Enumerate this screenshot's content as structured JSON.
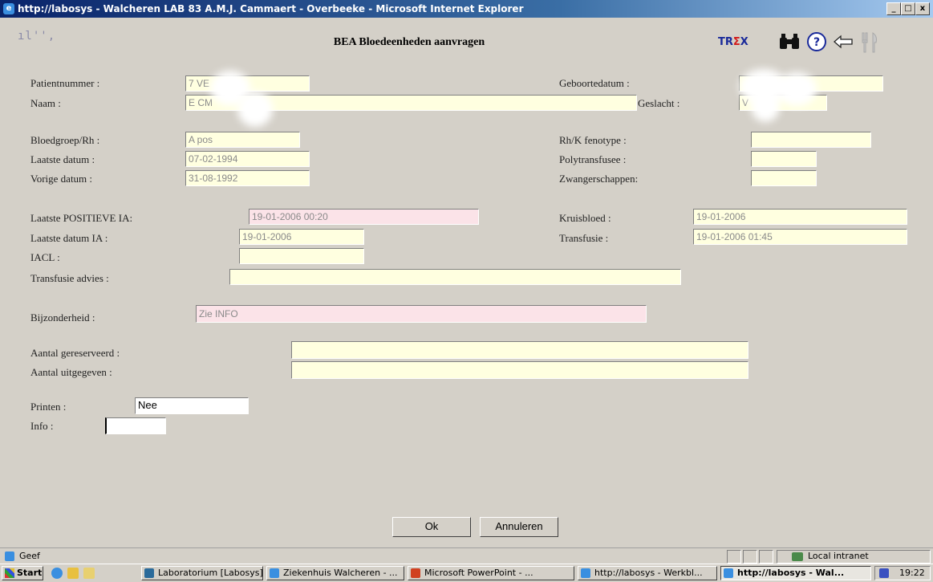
{
  "window": {
    "title": "http://labosys - Walcheren LAB 83 A.M.J. Cammaert - Overbeeke - Microsoft Internet Explorer",
    "controls": [
      "_",
      "□",
      "x"
    ]
  },
  "header": {
    "logo_text": "ıl'',",
    "page_title": "BEA Bloedeenheden aanvragen",
    "trex": {
      "tr": "TR",
      "e": "Σ",
      "x": "X"
    },
    "icons": [
      "binoculars-icon",
      "help-icon",
      "back-arrow-icon",
      "fork-knife-icon"
    ]
  },
  "patient": {
    "patientnummer_label": "Patientnummer :",
    "patientnummer_value": "7 VE",
    "geboortedatum_label": "Geboortedatum :",
    "geboortedatum_value": "",
    "naam_label": "Naam :",
    "naam_value": "E CM",
    "geslacht_label": "Geslacht :",
    "geslacht_value": "V"
  },
  "blood": {
    "bloedgroep_label": "Bloedgroep/Rh :",
    "bloedgroep_value": "A pos",
    "rhk_label": "Rh/K fenotype :",
    "rhk_value": "",
    "laatste_datum_label": "Laatste datum :",
    "laatste_datum_value": "07-02-1994",
    "polytransfusee_label": "Polytransfusee :",
    "polytransfusee_value": "",
    "vorige_datum_label": "Vorige datum :",
    "vorige_datum_value": "31-08-1992",
    "zwangerschappen_label": "Zwangerschappen:",
    "zwangerschappen_value": ""
  },
  "ia": {
    "laatste_positieve_label": "Laatste POSITIEVE IA:",
    "laatste_positieve_value": "19-01-2006 00:20",
    "kruisbloed_label": "Kruisbloed :",
    "kruisbloed_value": "19-01-2006",
    "laatste_datum_ia_label": "Laatste datum IA :",
    "laatste_datum_ia_value": "19-01-2006",
    "transfusie_label": "Transfusie :",
    "transfusie_value": "19-01-2006 01:45",
    "iacl_label": "IACL :",
    "iacl_value": "",
    "advies_label": "Transfusie advies :",
    "advies_value": ""
  },
  "bijzonderheid": {
    "label": "Bijzonderheid :",
    "value": "Zie INFO"
  },
  "aantal": {
    "gereserveerd_label": "Aantal gereserveerd :",
    "gereserveerd_value": "",
    "uitgegeven_label": "Aantal uitgegeven :",
    "uitgegeven_value": ""
  },
  "print": {
    "printen_label": "Printen :",
    "printen_value": "Nee",
    "info_label": "Info :",
    "info_value": ""
  },
  "buttons": {
    "ok": "Ok",
    "annuleren": "Annuleren"
  },
  "statusbar": {
    "left": "Geef",
    "zone": "Local intranet"
  },
  "taskbar": {
    "start": "Start",
    "items": [
      "Laboratorium [Labosys]",
      "Ziekenhuis Walcheren - ...",
      "Microsoft PowerPoint - ...",
      "http://labosys - Werkbl...",
      "http://labosys - Wal..."
    ],
    "clock": "19:22"
  }
}
